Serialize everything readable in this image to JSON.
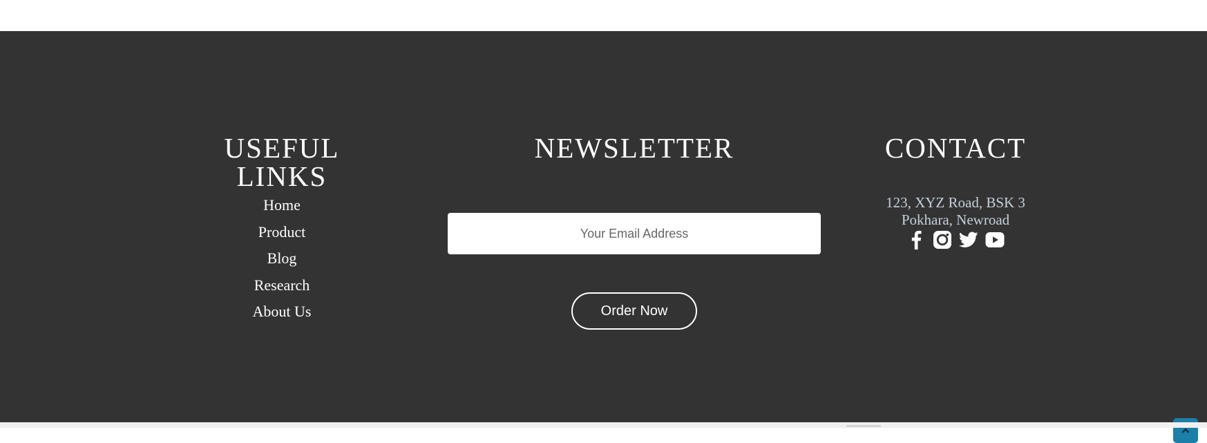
{
  "useful_links": {
    "title": "USEFUL LINKS",
    "items": [
      {
        "label": "Home"
      },
      {
        "label": "Product"
      },
      {
        "label": "Blog"
      },
      {
        "label": "Research"
      },
      {
        "label": "About Us"
      }
    ]
  },
  "newsletter": {
    "title": "NEWSLETTER",
    "email_placeholder": "Your Email Address",
    "button_label": "Order Now"
  },
  "contact": {
    "title": "CONTACT",
    "address_line1": "123, XYZ Road, BSK 3",
    "address_line2": "Pokhara, Newroad",
    "social_icons": [
      "facebook-icon",
      "instagram-icon",
      "twitter-icon",
      "youtube-icon"
    ]
  },
  "colors": {
    "footer_background": "#333333",
    "text": "#ffffff",
    "address_text": "#c6d0dc",
    "scroll_top_button": "#1b7fa8"
  },
  "scroll_top": {
    "icon": "chevron-up-icon"
  }
}
